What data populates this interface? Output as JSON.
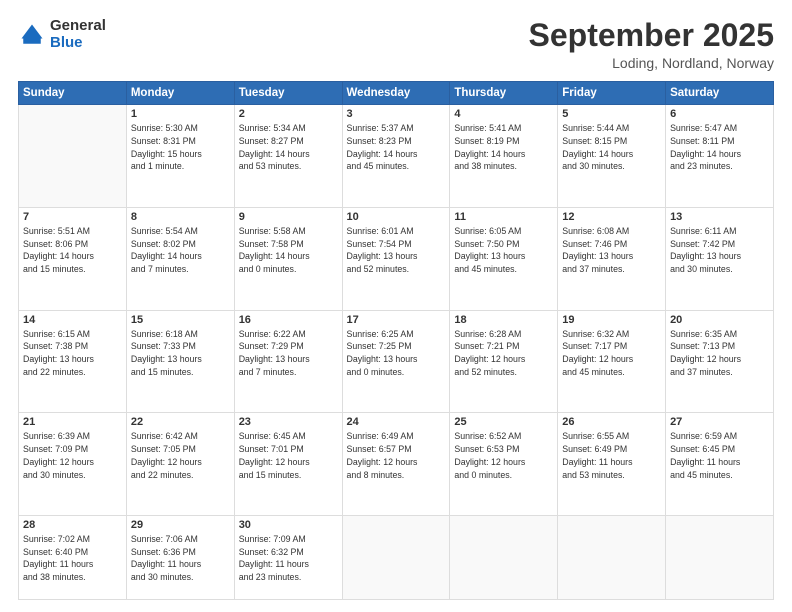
{
  "logo": {
    "general": "General",
    "blue": "Blue"
  },
  "header": {
    "title": "September 2025",
    "subtitle": "Loding, Nordland, Norway"
  },
  "weekdays": [
    "Sunday",
    "Monday",
    "Tuesday",
    "Wednesday",
    "Thursday",
    "Friday",
    "Saturday"
  ],
  "weeks": [
    [
      {
        "day": "",
        "info": ""
      },
      {
        "day": "1",
        "info": "Sunrise: 5:30 AM\nSunset: 8:31 PM\nDaylight: 15 hours\nand 1 minute."
      },
      {
        "day": "2",
        "info": "Sunrise: 5:34 AM\nSunset: 8:27 PM\nDaylight: 14 hours\nand 53 minutes."
      },
      {
        "day": "3",
        "info": "Sunrise: 5:37 AM\nSunset: 8:23 PM\nDaylight: 14 hours\nand 45 minutes."
      },
      {
        "day": "4",
        "info": "Sunrise: 5:41 AM\nSunset: 8:19 PM\nDaylight: 14 hours\nand 38 minutes."
      },
      {
        "day": "5",
        "info": "Sunrise: 5:44 AM\nSunset: 8:15 PM\nDaylight: 14 hours\nand 30 minutes."
      },
      {
        "day": "6",
        "info": "Sunrise: 5:47 AM\nSunset: 8:11 PM\nDaylight: 14 hours\nand 23 minutes."
      }
    ],
    [
      {
        "day": "7",
        "info": "Sunrise: 5:51 AM\nSunset: 8:06 PM\nDaylight: 14 hours\nand 15 minutes."
      },
      {
        "day": "8",
        "info": "Sunrise: 5:54 AM\nSunset: 8:02 PM\nDaylight: 14 hours\nand 7 minutes."
      },
      {
        "day": "9",
        "info": "Sunrise: 5:58 AM\nSunset: 7:58 PM\nDaylight: 14 hours\nand 0 minutes."
      },
      {
        "day": "10",
        "info": "Sunrise: 6:01 AM\nSunset: 7:54 PM\nDaylight: 13 hours\nand 52 minutes."
      },
      {
        "day": "11",
        "info": "Sunrise: 6:05 AM\nSunset: 7:50 PM\nDaylight: 13 hours\nand 45 minutes."
      },
      {
        "day": "12",
        "info": "Sunrise: 6:08 AM\nSunset: 7:46 PM\nDaylight: 13 hours\nand 37 minutes."
      },
      {
        "day": "13",
        "info": "Sunrise: 6:11 AM\nSunset: 7:42 PM\nDaylight: 13 hours\nand 30 minutes."
      }
    ],
    [
      {
        "day": "14",
        "info": "Sunrise: 6:15 AM\nSunset: 7:38 PM\nDaylight: 13 hours\nand 22 minutes."
      },
      {
        "day": "15",
        "info": "Sunrise: 6:18 AM\nSunset: 7:33 PM\nDaylight: 13 hours\nand 15 minutes."
      },
      {
        "day": "16",
        "info": "Sunrise: 6:22 AM\nSunset: 7:29 PM\nDaylight: 13 hours\nand 7 minutes."
      },
      {
        "day": "17",
        "info": "Sunrise: 6:25 AM\nSunset: 7:25 PM\nDaylight: 13 hours\nand 0 minutes."
      },
      {
        "day": "18",
        "info": "Sunrise: 6:28 AM\nSunset: 7:21 PM\nDaylight: 12 hours\nand 52 minutes."
      },
      {
        "day": "19",
        "info": "Sunrise: 6:32 AM\nSunset: 7:17 PM\nDaylight: 12 hours\nand 45 minutes."
      },
      {
        "day": "20",
        "info": "Sunrise: 6:35 AM\nSunset: 7:13 PM\nDaylight: 12 hours\nand 37 minutes."
      }
    ],
    [
      {
        "day": "21",
        "info": "Sunrise: 6:39 AM\nSunset: 7:09 PM\nDaylight: 12 hours\nand 30 minutes."
      },
      {
        "day": "22",
        "info": "Sunrise: 6:42 AM\nSunset: 7:05 PM\nDaylight: 12 hours\nand 22 minutes."
      },
      {
        "day": "23",
        "info": "Sunrise: 6:45 AM\nSunset: 7:01 PM\nDaylight: 12 hours\nand 15 minutes."
      },
      {
        "day": "24",
        "info": "Sunrise: 6:49 AM\nSunset: 6:57 PM\nDaylight: 12 hours\nand 8 minutes."
      },
      {
        "day": "25",
        "info": "Sunrise: 6:52 AM\nSunset: 6:53 PM\nDaylight: 12 hours\nand 0 minutes."
      },
      {
        "day": "26",
        "info": "Sunrise: 6:55 AM\nSunset: 6:49 PM\nDaylight: 11 hours\nand 53 minutes."
      },
      {
        "day": "27",
        "info": "Sunrise: 6:59 AM\nSunset: 6:45 PM\nDaylight: 11 hours\nand 45 minutes."
      }
    ],
    [
      {
        "day": "28",
        "info": "Sunrise: 7:02 AM\nSunset: 6:40 PM\nDaylight: 11 hours\nand 38 minutes."
      },
      {
        "day": "29",
        "info": "Sunrise: 7:06 AM\nSunset: 6:36 PM\nDaylight: 11 hours\nand 30 minutes."
      },
      {
        "day": "30",
        "info": "Sunrise: 7:09 AM\nSunset: 6:32 PM\nDaylight: 11 hours\nand 23 minutes."
      },
      {
        "day": "",
        "info": ""
      },
      {
        "day": "",
        "info": ""
      },
      {
        "day": "",
        "info": ""
      },
      {
        "day": "",
        "info": ""
      }
    ]
  ]
}
